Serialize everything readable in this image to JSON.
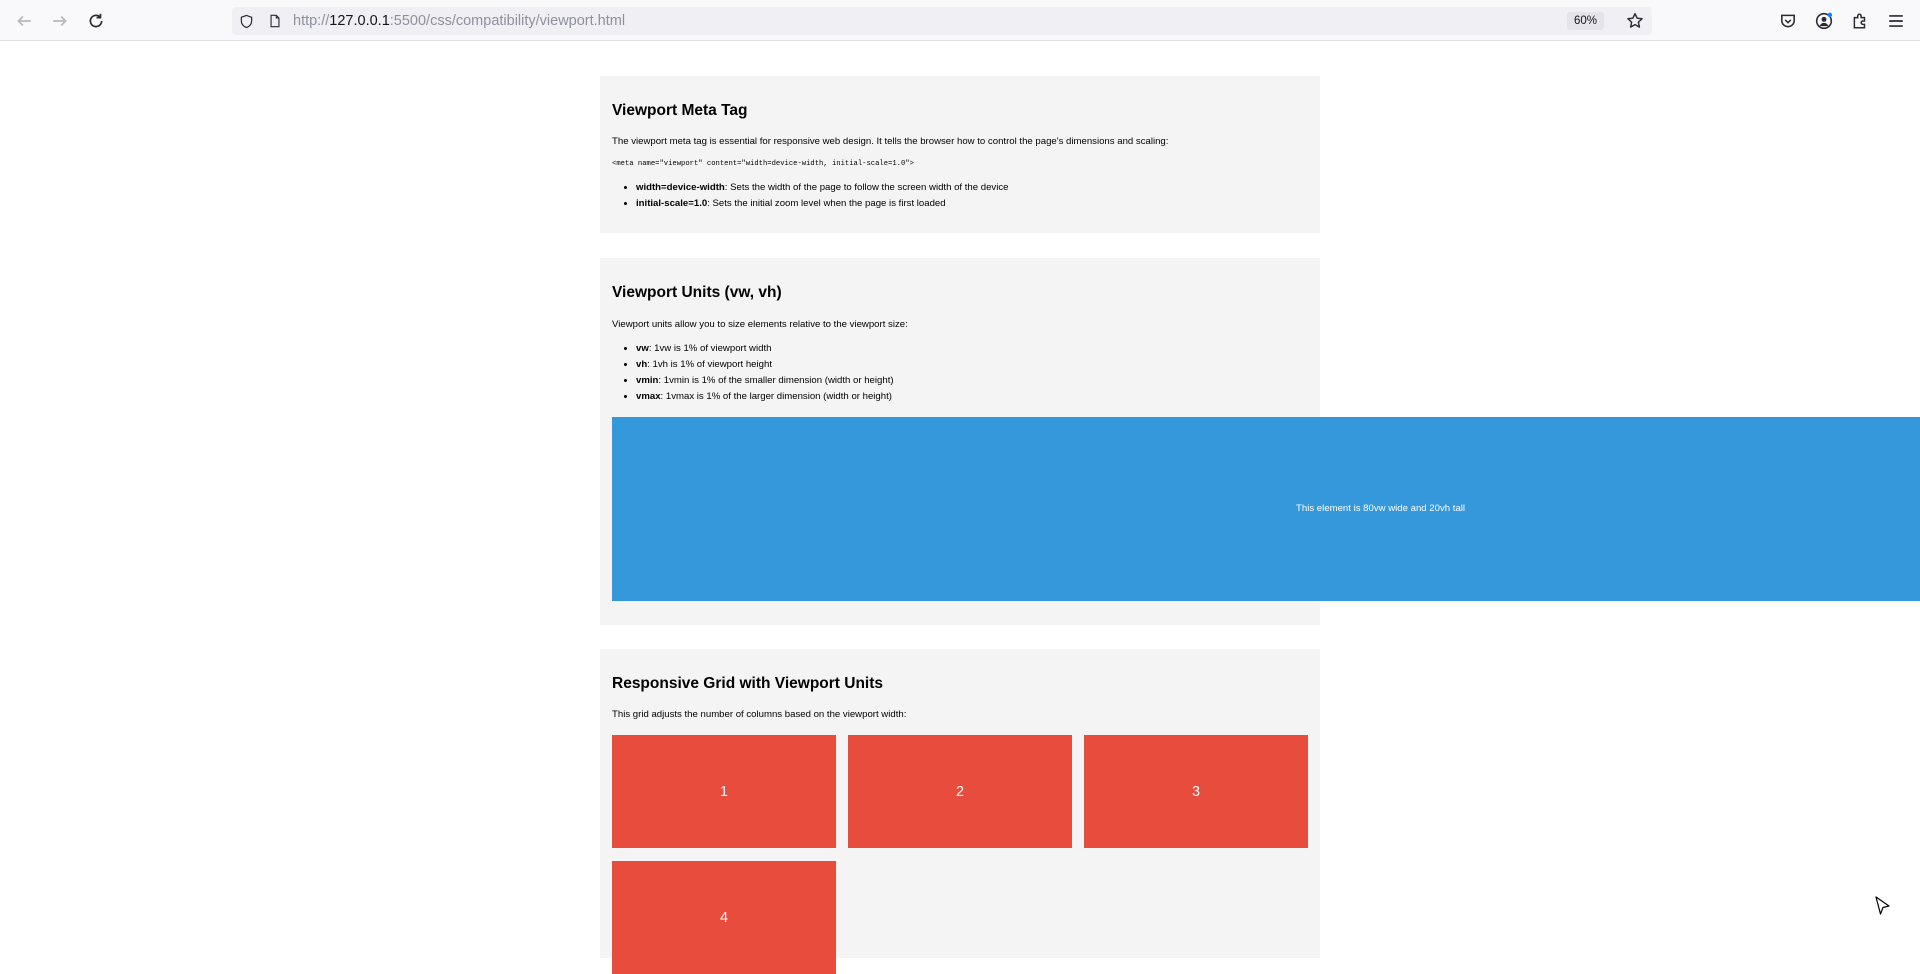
{
  "browser": {
    "url_prefix": "http://",
    "url_host": "127.0.0.1",
    "url_path": ":5500/css/compatibility/viewport.html",
    "zoom": "60%"
  },
  "sections": {
    "meta": {
      "title": "Viewport Meta Tag",
      "description": "The viewport meta tag is essential for responsive web design. It tells the browser how to control the page's dimensions and scaling:",
      "code": "<meta name=\"viewport\" content=\"width=device-width, initial-scale=1.0\">",
      "items": [
        {
          "term": "width=device-width",
          "desc": ": Sets the width of the page to follow the screen width of the device"
        },
        {
          "term": "initial-scale=1.0",
          "desc": ": Sets the initial zoom level when the page is first loaded"
        }
      ]
    },
    "units": {
      "title": "Viewport Units (vw, vh)",
      "description": "Viewport units allow you to size elements relative to the viewport size:",
      "items": [
        {
          "term": "vw",
          "desc": ": 1vw is 1% of viewport width"
        },
        {
          "term": "vh",
          "desc": ": 1vh is 1% of viewport height"
        },
        {
          "term": "vmin",
          "desc": ": 1vmin is 1% of the smaller dimension (width or height)"
        },
        {
          "term": "vmax",
          "desc": ": 1vmax is 1% of the larger dimension (width or height)"
        }
      ],
      "demo_text": "This element is 80vw wide and 20vh tall",
      "demo_color": "#3498db"
    },
    "grid": {
      "title": "Responsive Grid with Viewport Units",
      "description": "This grid adjusts the number of columns based on the viewport width:",
      "cells": [
        "1",
        "2",
        "3",
        "4"
      ],
      "cell_color": "#e74c3c"
    }
  }
}
